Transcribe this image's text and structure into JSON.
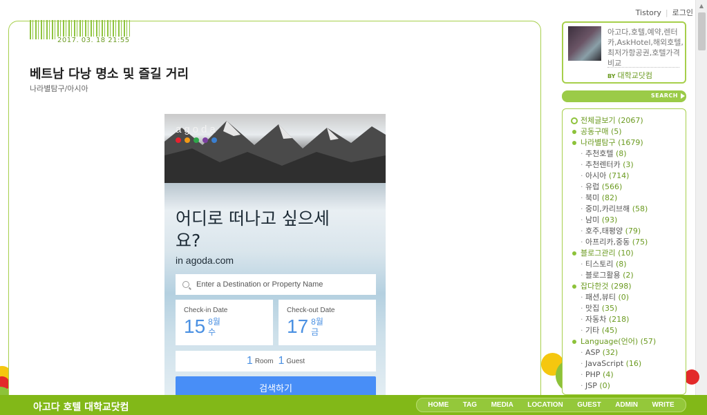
{
  "toplinks": {
    "tistory": "Tistory",
    "login": "로그인"
  },
  "post": {
    "date": "2017. 03. 18 21:55",
    "title": "베트남 다낭 명소 및 즐길 거리",
    "category": "나라별탐구/아시아"
  },
  "widget": {
    "logo": "agoda",
    "headline": "어디로 떠나고 싶으세요?",
    "subline": "in agoda.com",
    "search_placeholder": "Enter a Destination or Property Name",
    "checkin": {
      "label": "Check-in Date",
      "day": "15",
      "month": "8월",
      "weekday": "수"
    },
    "checkout": {
      "label": "Check-out Date",
      "day": "17",
      "month": "8월",
      "weekday": "금"
    },
    "rooms_count": "1",
    "rooms_label": "Room",
    "guests_count": "1",
    "guests_label": "Guest",
    "search_button": "검색하기",
    "dot_colors": [
      "#e8212e",
      "#f29a16",
      "#2ea84a",
      "#7b3fa0",
      "#3a7fd1"
    ]
  },
  "profile": {
    "description": "아고다,호텔,예약,렌터카,AskHotel,해외호텔,최저가항공권,호텔가격비교",
    "by_label": "BY",
    "by_name": "대학교닷컴"
  },
  "sidebar": {
    "search_label": "SEARCH",
    "categories": [
      {
        "label": "전체글보기 ",
        "count": "(2067)",
        "level": "root"
      },
      {
        "label": "공동구매 ",
        "count": "(5)",
        "level": "top"
      },
      {
        "label": "나라별탐구 ",
        "count": "(1679)",
        "level": "top"
      },
      {
        "label": "추천호텔 ",
        "count": "(8)",
        "level": "sub"
      },
      {
        "label": "추천렌터카 ",
        "count": "(3)",
        "level": "sub"
      },
      {
        "label": "아시아 ",
        "count": "(714)",
        "level": "sub"
      },
      {
        "label": "유럽 ",
        "count": "(566)",
        "level": "sub"
      },
      {
        "label": "북미 ",
        "count": "(82)",
        "level": "sub"
      },
      {
        "label": "중미,카리브해 ",
        "count": "(58)",
        "level": "sub"
      },
      {
        "label": "남미 ",
        "count": "(93)",
        "level": "sub"
      },
      {
        "label": "호주,태평양 ",
        "count": "(79)",
        "level": "sub"
      },
      {
        "label": "아프리카,중동 ",
        "count": "(75)",
        "level": "sub"
      },
      {
        "label": "블로그관리 ",
        "count": "(10)",
        "level": "top"
      },
      {
        "label": "티스토리 ",
        "count": "(8)",
        "level": "sub"
      },
      {
        "label": "블로그활용 ",
        "count": "(2)",
        "level": "sub"
      },
      {
        "label": "잡다한것 ",
        "count": "(298)",
        "level": "top"
      },
      {
        "label": "패션,뷰티 ",
        "count": "(0)",
        "level": "sub"
      },
      {
        "label": "맛집 ",
        "count": "(35)",
        "level": "sub"
      },
      {
        "label": "자동차 ",
        "count": "(218)",
        "level": "sub"
      },
      {
        "label": "기타 ",
        "count": "(45)",
        "level": "sub"
      },
      {
        "label": "Language(언어) ",
        "count": "(57)",
        "level": "top"
      },
      {
        "label": "ASP ",
        "count": "(32)",
        "level": "sub"
      },
      {
        "label": "JavaScript ",
        "count": "(16)",
        "level": "sub"
      },
      {
        "label": "PHP ",
        "count": "(4)",
        "level": "sub"
      },
      {
        "label": "JSP ",
        "count": "(0)",
        "level": "sub"
      }
    ]
  },
  "footer": {
    "title": "아고다 호텔 대학교닷컴",
    "nav": [
      "HOME",
      "TAG",
      "MEDIA",
      "LOCATION",
      "GUEST",
      "ADMIN",
      "WRITE"
    ]
  },
  "colors": {
    "accent_green": "#82b818",
    "border_green": "#a6cf4a",
    "link_green": "#6a9a1f",
    "agoda_blue": "#488ef7"
  }
}
